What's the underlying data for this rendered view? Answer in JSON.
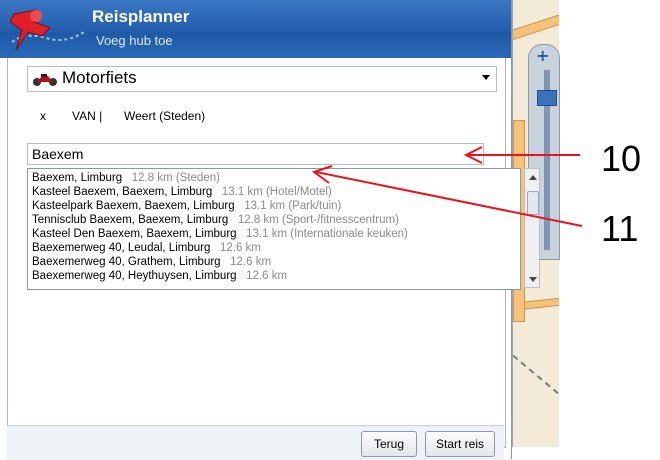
{
  "header": {
    "title": "Reisplanner",
    "subtitle": "Voeg hub toe"
  },
  "vehicle": {
    "icon": "motorcycle-icon",
    "label": "Motorfiets"
  },
  "route": {
    "remove": "x",
    "from_label": "VAN |",
    "from_value": "Weert (Steden)"
  },
  "search": {
    "value": "Baexem"
  },
  "results": [
    {
      "name": "Baexem, Limburg",
      "meta": "12.8 km (Steden)"
    },
    {
      "name": "Kasteel Baexem, Baexem, Limburg",
      "meta": "13.1 km (Hotel/Motel)"
    },
    {
      "name": "Kasteelpark Baexem, Baexem, Limburg",
      "meta": "13.1 km (Park/tuin)"
    },
    {
      "name": "Tennisclub Baexem, Baexem, Limburg",
      "meta": "12.8 km (Sport-/fitnesscentrum)"
    },
    {
      "name": "Kasteel Den Baexem, Baexem, Limburg",
      "meta": "13.1 km (Internationale keuken)"
    },
    {
      "name": "Baexemerweg 40, Leudal, Limburg",
      "meta": "12.6 km"
    },
    {
      "name": "Baexemerweg 40, Grathem, Limburg",
      "meta": "12.6 km"
    },
    {
      "name": "Baexemerweg 40, Heythuysen, Limburg",
      "meta": "12.6 km"
    }
  ],
  "buttons": {
    "back": "Terug",
    "start": "Start reis"
  },
  "annotations": {
    "label_10": "10",
    "label_11": "11",
    "arrow_color": "#e8141e"
  },
  "colors": {
    "header": "#2a68b7",
    "map_bg": "#f3ead8"
  }
}
